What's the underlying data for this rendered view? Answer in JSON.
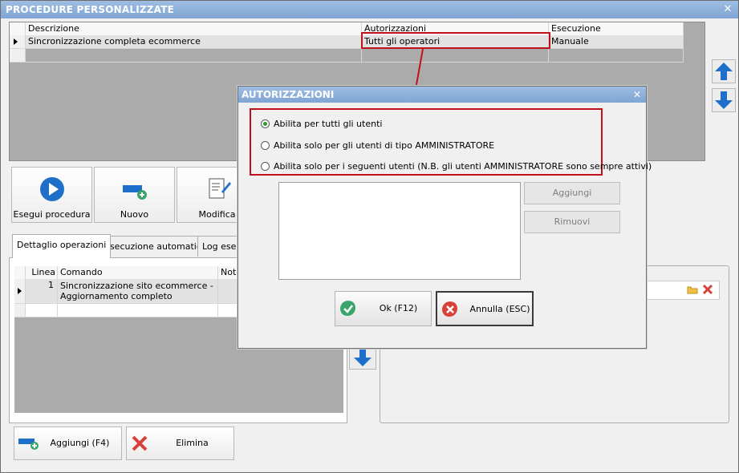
{
  "window": {
    "title": "PROCEDURE PERSONALIZZATE",
    "close": "✕"
  },
  "procedures_grid": {
    "headers": {
      "description": "Descrizione",
      "authorizations": "Autorizzazioni",
      "execution": "Esecuzione"
    },
    "rows": [
      {
        "description": "Sincronizzazione completa ecommerce",
        "authorizations": "Tutti gli operatori",
        "execution": "Manuale"
      }
    ]
  },
  "toolbar": {
    "run_label": "Esegui procedura",
    "new_label": "Nuovo",
    "edit_label": "Modifica"
  },
  "tabs": {
    "details": "Dettaglio operazioni",
    "auto_exec": "Esecuzione automatica",
    "log": "Log esecu"
  },
  "operations_grid": {
    "headers": {
      "line": "Linea",
      "command": "Comando",
      "notes": "Note"
    },
    "rows": [
      {
        "line": "1",
        "command_line1": "Sincronizzazione sito ecommerce -",
        "command_line2": "Aggiornamento completo"
      }
    ]
  },
  "bottom": {
    "add_label": "Aggiungi (F4)",
    "delete_label": "Elimina"
  },
  "dialog": {
    "title": "AUTORIZZAZIONI",
    "close": "✕",
    "options": [
      {
        "label": "Abilita per tutti gli utenti",
        "selected": true
      },
      {
        "label": "Abilita solo per gli utenti di tipo AMMINISTRATORE",
        "selected": false
      },
      {
        "label": "Abilita solo per i seguenti utenti (N.B. gli utenti AMMINISTRATORE sono sempre attivi)",
        "selected": false
      }
    ],
    "add_label": "Aggiungi",
    "remove_label": "Rimuovi",
    "ok_label": "Ok (F12)",
    "cancel_label": "Annulla (ESC)"
  },
  "colors": {
    "titlebar": "#8fb1dc",
    "highlight": "#c0101a",
    "accent_blue": "#1e6fc9",
    "ok_green": "#3aa56b",
    "cancel_red": "#d8413a"
  }
}
